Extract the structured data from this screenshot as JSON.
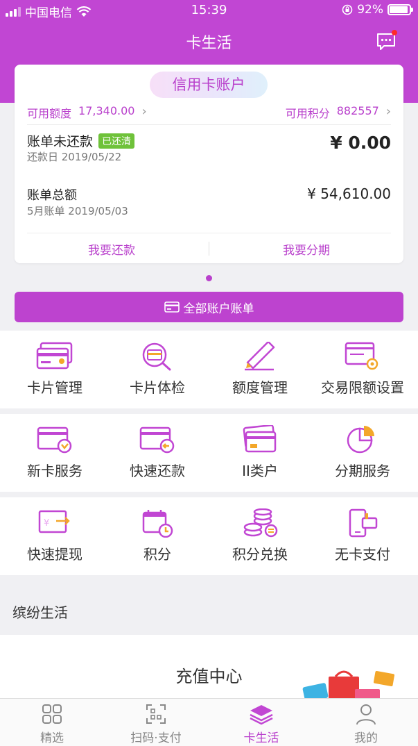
{
  "status_bar": {
    "carrier": "中国电信",
    "time": "15:39",
    "battery": "92%",
    "battery_level": 0.92
  },
  "nav": {
    "title": "卡生活"
  },
  "account_card": {
    "pill": "信用卡账户",
    "available_credit_label": "可用额度",
    "available_credit_value": "17,340.00",
    "available_points_label": "可用积分",
    "available_points_value": "882557",
    "bill_unpaid_label": "账单未还款",
    "bill_status_tag": "已还清",
    "due_date": "还款日 2019/05/22",
    "unpaid_amount": "¥ 0.00",
    "bill_total_label": "账单总额",
    "bill_month": "5月账单 2019/05/03",
    "bill_total_amount": "¥ 54,610.00",
    "repay_label": "我要还款",
    "installment_label": "我要分期"
  },
  "all_bills_label": "全部账户账单",
  "grid_row1": [
    {
      "label": "卡片管理",
      "icon": "card-manage-icon"
    },
    {
      "label": "卡片体检",
      "icon": "card-check-icon"
    },
    {
      "label": "额度管理",
      "icon": "pencil-icon"
    },
    {
      "label": "交易限额设置",
      "icon": "limit-settings-icon"
    }
  ],
  "grid_row2": [
    {
      "label": "新卡服务",
      "icon": "new-card-icon"
    },
    {
      "label": "快速还款",
      "icon": "quick-repay-icon"
    },
    {
      "label": "II类户",
      "icon": "class2-account-icon"
    },
    {
      "label": "分期服务",
      "icon": "pie-chart-icon"
    }
  ],
  "grid_row3": [
    {
      "label": "快速提现",
      "icon": "withdraw-icon"
    },
    {
      "label": "积分",
      "icon": "points-calendar-icon"
    },
    {
      "label": "积分兑换",
      "icon": "coins-exchange-icon"
    },
    {
      "label": "无卡支付",
      "icon": "cardless-pay-icon"
    }
  ],
  "section_title": "缤纷生活",
  "promo_title": "充值中心",
  "tabs": [
    {
      "label": "精选",
      "icon": "grid-icon"
    },
    {
      "label": "扫码·支付",
      "icon": "scan-icon"
    },
    {
      "label": "卡生活",
      "icon": "layers-icon"
    },
    {
      "label": "我的",
      "icon": "person-icon"
    }
  ],
  "colors": {
    "brand": "#c146d3",
    "status_green": "#6fc23a"
  }
}
